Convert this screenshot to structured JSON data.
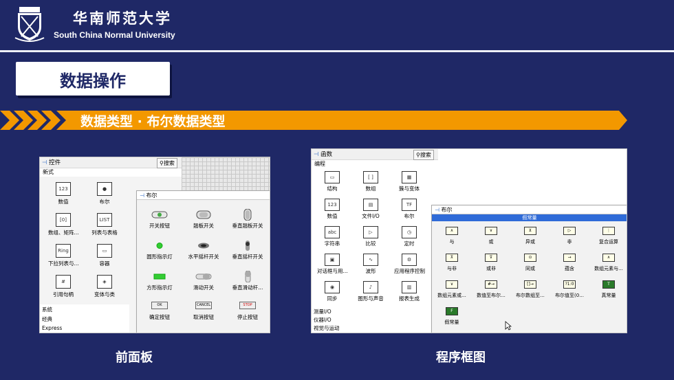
{
  "header": {
    "univ_cn": "华南师范大学",
    "univ_en": "South China Normal University"
  },
  "title": "数据操作",
  "banner": {
    "text": "数据类型  ·  布尔数据类型",
    "color": "#f39800"
  },
  "front_panel": {
    "pane_title": "控件",
    "search": "搜索",
    "subtitle": "新式",
    "palette": [
      {
        "label": "数值",
        "icon": "123"
      },
      {
        "label": "布尔",
        "icon": "●"
      },
      {
        "label": "数组、矩阵...",
        "icon": "[0]"
      },
      {
        "label": "列表与表格",
        "icon": "LIST"
      },
      {
        "label": "下拉列表与...",
        "icon": "Ring"
      },
      {
        "label": "容器",
        "icon": "▭"
      },
      {
        "label": "引用句柄",
        "icon": "#"
      },
      {
        "label": "变体与类",
        "icon": "◈"
      }
    ],
    "sub_items": [
      "系统",
      "经典",
      "Express"
    ],
    "popup_title": "布尔",
    "controls": [
      {
        "label": "开关按钮"
      },
      {
        "label": "翘板开关"
      },
      {
        "label": "垂直翘板开关"
      },
      {
        "label": "圆形指示灯"
      },
      {
        "label": "水平摇杆开关"
      },
      {
        "label": "垂直摇杆开关"
      },
      {
        "label": "方形指示灯"
      },
      {
        "label": "滑动开关"
      },
      {
        "label": "垂直滑动杆..."
      },
      {
        "label": "确定按钮",
        "icon": "OK"
      },
      {
        "label": "取消按钮",
        "icon": "CANCEL"
      },
      {
        "label": "停止按钮",
        "icon": "STOP"
      }
    ]
  },
  "block_diagram": {
    "pane_title": "函数",
    "search": "搜索",
    "subtitle": "编程",
    "palette": [
      {
        "label": "结构",
        "icon": "▭"
      },
      {
        "label": "数组",
        "icon": "[ ]"
      },
      {
        "label": "簇与变体",
        "icon": "▦"
      },
      {
        "label": "数值",
        "icon": "123"
      },
      {
        "label": "文件I/O",
        "icon": "▤"
      },
      {
        "label": "布尔",
        "icon": "TF"
      },
      {
        "label": "字符串",
        "icon": "abc"
      },
      {
        "label": "比较",
        "icon": "▷"
      },
      {
        "label": "定时",
        "icon": "◷"
      },
      {
        "label": "对话框与用...",
        "icon": "▣"
      },
      {
        "label": "波形",
        "icon": "∿"
      },
      {
        "label": "应用程序控制",
        "icon": "⚙"
      },
      {
        "label": "同步",
        "icon": "◉"
      },
      {
        "label": "图形与声音",
        "icon": "♪"
      },
      {
        "label": "报表生成",
        "icon": "▥"
      }
    ],
    "sub_items": [
      "测量I/O",
      "仪器I/O",
      "视觉与运动"
    ],
    "popup_title": "布尔",
    "highlight": "假常量",
    "functions": [
      {
        "label": "与",
        "icon": "∧"
      },
      {
        "label": "或",
        "icon": "∨"
      },
      {
        "label": "异或",
        "icon": "⊻"
      },
      {
        "label": "非",
        "icon": "▷"
      },
      {
        "label": "复合运算",
        "icon": "⋮"
      },
      {
        "label": "与非",
        "icon": "⊼"
      },
      {
        "label": "或非",
        "icon": "⊽"
      },
      {
        "label": "同或",
        "icon": "⊙"
      },
      {
        "label": "蕴含",
        "icon": "→"
      },
      {
        "label": "数组元素与...",
        "icon": "∧"
      },
      {
        "label": "数组元素或...",
        "icon": "∨"
      },
      {
        "label": "数值至布尔...",
        "icon": "#→"
      },
      {
        "label": "布尔数组至...",
        "icon": "[]→"
      },
      {
        "label": "布尔值至(0...",
        "icon": "?1:0"
      },
      {
        "label": "真常量",
        "icon": "T"
      },
      {
        "label": "假常量",
        "icon": "F"
      }
    ]
  },
  "captions": {
    "left": "前面板",
    "right": "程序框图"
  }
}
